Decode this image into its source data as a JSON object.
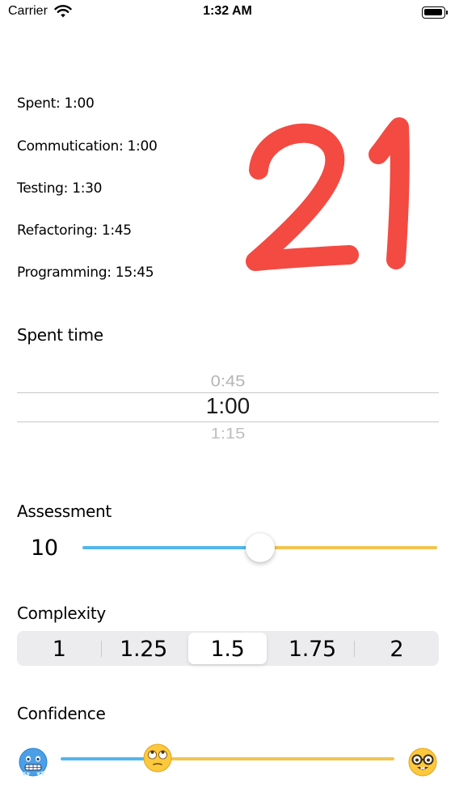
{
  "status_bar": {
    "carrier": "Carrier",
    "time": "1:32 AM"
  },
  "stats": [
    "Spent: 1:00",
    "Commutication: 1:00",
    "Testing: 1:30",
    "Refactoring: 1:45",
    "Programming: 15:45"
  ],
  "score": "21",
  "colors": {
    "score_red": "#f34a42",
    "track_blue": "#52b7ec",
    "track_yellow": "#f2c54f"
  },
  "spent_time": {
    "title": "Spent time",
    "options": [
      "0:45",
      "1:00",
      "1:15"
    ],
    "selected": "1:00"
  },
  "assessment": {
    "title": "Assessment",
    "value": "10",
    "slider_fraction": 0.5
  },
  "complexity": {
    "title": "Complexity",
    "options": [
      "1",
      "1.25",
      "1.5",
      "1.75",
      "2"
    ],
    "selected_index": 2
  },
  "confidence": {
    "title": "Confidence",
    "slider_fraction": 0.29,
    "min_icon": "freezing-face-icon",
    "thumb_icon": "rolling-eyes-face-icon",
    "max_icon": "nerd-face-icon"
  }
}
